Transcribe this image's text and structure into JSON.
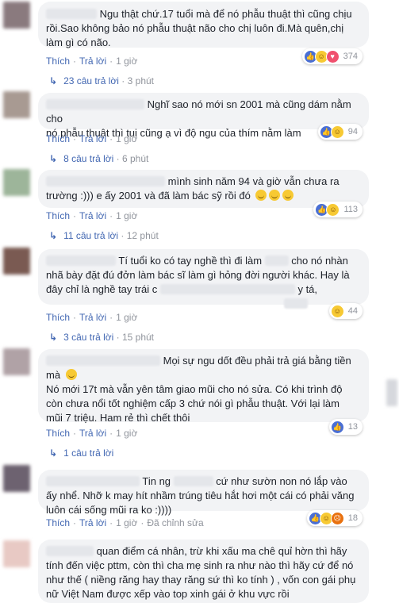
{
  "actions": {
    "like": "Thích",
    "reply": "Trả lời",
    "edited": "Đã chỉnh sửa"
  },
  "comments": [
    {
      "text_lines": [
        "Ngu thật chứ.17 tuổi mà để nó phẫu thuật thì cũng chịu",
        "rồi.Sao không bảo nó phẫu thuật não cho chị luôn đi.Mà quên,chị",
        "làm gì có não."
      ],
      "time": "1 giờ",
      "reaction_count": "374",
      "reactions": [
        "like",
        "haha",
        "love"
      ],
      "replies": "23 câu trả lời",
      "replies_time": "3 phút"
    },
    {
      "text_lines": [
        "Nghĩ sao nó mới sn 2001 mà cũng dám nằm cho",
        "nó phẫu thuật thì tui cũng ạ vì độ ngu của thím nằm làm"
      ],
      "time": "1 giờ",
      "reaction_count": "94",
      "reactions": [
        "like",
        "haha"
      ],
      "replies": "8 câu trả lời",
      "replies_time": "6 phút"
    },
    {
      "text_lines": [
        "mình sinh năm 94 và giờ vẫn chưa ra",
        "trường :))) e ấy 2001 và đã làm bác sỹ rồi đó"
      ],
      "time": "1 giờ",
      "reaction_count": "113",
      "reactions": [
        "like",
        "haha"
      ],
      "replies": "11 câu trả lời",
      "replies_time": "12 phút"
    },
    {
      "text_lines": [
        "Tí tuổi ko có tay nghề thì đi làm",
        "cho nó nhàn",
        "nhã bày đặt đú đởn làm bác sĩ làm gì hỏng đời người khác. Hay là",
        "đây chỉ là nghề tay trái c",
        "y tá,"
      ],
      "time": "1 giờ",
      "reaction_count": "44",
      "reactions": [
        "haha"
      ],
      "replies": "3 câu trả lời",
      "replies_time": "15 phút"
    },
    {
      "text_lines": [
        "Mọi sự ngu dốt đều phải trả giá bằng tiền",
        "mà",
        "Nó mới 17t mà vẫn yên tâm giao mũi cho nó sửa. Có khi trình độ",
        "còn chưa nổi tốt nghiệm cấp 3 chứ nói gì phẫu thuật. Với lại làm",
        "mũi 7 triệu. Ham rẻ thì chết thôi"
      ],
      "time": "1 giờ",
      "reaction_count": "13",
      "reactions": [
        "like"
      ],
      "replies": "1 câu trả lời"
    },
    {
      "text_lines": [
        "Tin ng",
        "cứ như sườn non nó lắp vào",
        "ấy nhể. Nhỡ k may hít nhầm trúng tiêu hắt hơi một cái có phải văng",
        "luôn cái sống mũi ra ko :))))"
      ],
      "time": "1 giờ",
      "reaction_count": "18",
      "reactions": [
        "like",
        "haha",
        "angry"
      ]
    },
    {
      "text_lines": [
        "quan điểm cá nhân, trừ khi xấu ma chê quỉ hờn thì hãy",
        "tính đến việc pttm, còn thì cha mẹ sinh ra như nào thì hãy cứ để nó",
        "như thế ( niềng răng hay thay răng sứ thì ko tính ) , vốn con gái phụ",
        "nữ Việt Nam được xếp vào top xinh gái ở khu vực rồi"
      ]
    }
  ]
}
